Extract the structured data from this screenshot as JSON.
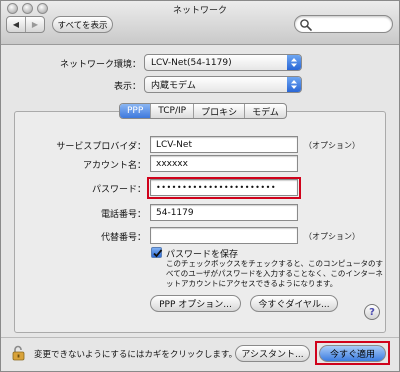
{
  "window": {
    "title": "ネットワーク"
  },
  "toolbar": {
    "back_label": "◀",
    "forward_label": "▶",
    "show_all_label": "すべてを表示",
    "search_placeholder": ""
  },
  "config": {
    "location_label": "ネットワーク環境：",
    "location_value": "LCV-Net(54-1179)",
    "show_label": "表示：",
    "show_value": "内蔵モデム"
  },
  "tabs": [
    {
      "label": "PPP",
      "active": true
    },
    {
      "label": "TCP/IP",
      "active": false
    },
    {
      "label": "プロキシ",
      "active": false
    },
    {
      "label": "モデム",
      "active": false
    }
  ],
  "ppp": {
    "service_provider_label": "サービスプロバイダ：",
    "service_provider_value": "LCV-Net",
    "service_provider_optional": "（オプション）",
    "account_label": "アカウント名：",
    "account_value": "xxxxxx",
    "password_label": "パスワード：",
    "password_value": "•••••••••••••••••••••••",
    "phone_label": "電話番号：",
    "phone_value": "54-1179",
    "alt_phone_label": "代替番号：",
    "alt_phone_value": "",
    "alt_phone_optional": "（オプション）",
    "save_password_label": "パスワードを保存",
    "save_password_checked": true,
    "save_password_note": "このチェックボックスをチェックすると、このコンピュータのすべてのユーザがパスワードを入力することなく、このインターネットアカウントにアクセスできるようになります。",
    "ppp_options_label": "PPP オプション...",
    "dial_now_label": "今すぐダイヤル...",
    "help_label": "?"
  },
  "footer": {
    "lock_text": "変更できないようにするにはカギをクリックします。",
    "assistant_label": "アシスタント...",
    "apply_label": "今すぐ適用"
  },
  "colors": {
    "highlight": "#d0021b",
    "accent": "#3e79dd"
  }
}
